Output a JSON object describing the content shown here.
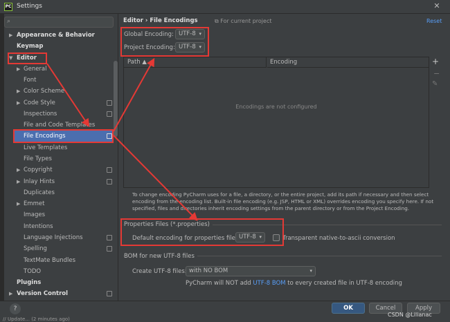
{
  "window": {
    "title": "Settings",
    "app_icon": "PC"
  },
  "sidebar": {
    "items": [
      {
        "label": "Appearance & Behavior"
      },
      {
        "label": "Keymap"
      },
      {
        "label": "Editor"
      },
      {
        "label": "General"
      },
      {
        "label": "Font"
      },
      {
        "label": "Color Scheme"
      },
      {
        "label": "Code Style"
      },
      {
        "label": "Inspections"
      },
      {
        "label": "File and Code Templates"
      },
      {
        "label": "File Encodings"
      },
      {
        "label": "Live Templates"
      },
      {
        "label": "File Types"
      },
      {
        "label": "Copyright"
      },
      {
        "label": "Inlay Hints"
      },
      {
        "label": "Duplicates"
      },
      {
        "label": "Emmet"
      },
      {
        "label": "Images"
      },
      {
        "label": "Intentions"
      },
      {
        "label": "Language Injections"
      },
      {
        "label": "Spelling"
      },
      {
        "label": "TextMate Bundles"
      },
      {
        "label": "TODO"
      },
      {
        "label": "Plugins"
      },
      {
        "label": "Version Control"
      }
    ]
  },
  "main": {
    "breadcrumb": "Editor  ›  File Encodings",
    "project_note": "For current project",
    "reset": "Reset",
    "global_label": "Global Encoding:",
    "global_value": "UTF-8",
    "project_label": "Project Encoding:",
    "project_value": "UTF-8",
    "table": {
      "col_path": "Path ▲",
      "col_encoding": "Encoding",
      "empty_text": "Encodings are not configured"
    },
    "description": "To change encoding PyCharm uses for a file, a directory, or the entire project, add its path if necessary and then select encoding from the encoding list. Built-in file encoding (e.g. JSP, HTML or XML) overrides encoding you specify here. If not specified, files and directories inherit encoding settings from the parent directory or from the Project Encoding.",
    "properties": {
      "section_title": "Properties Files (*.properties)",
      "default_label": "Default encoding for properties files:",
      "default_value": "UTF-8",
      "transparent_label": "Transparent native-to-ascii conversion"
    },
    "bom": {
      "section_title": "BOM for new UTF-8 files",
      "create_label": "Create UTF-8 files:",
      "create_value": "with NO BOM",
      "note_prefix": "PyCharm will NOT add",
      "note_link": "UTF-8 BOM",
      "note_suffix": "to every created file in UTF-8 encoding"
    }
  },
  "footer": {
    "help": "?",
    "ok": "OK",
    "cancel": "Cancel",
    "apply": "Apply"
  },
  "status_text": "// Update... (2 minutes ago)",
  "watermark": "CSDN @Lilianac",
  "colors": {
    "accent": "#4b6eaf",
    "link": "#589df6",
    "annotation": "#e53935"
  }
}
